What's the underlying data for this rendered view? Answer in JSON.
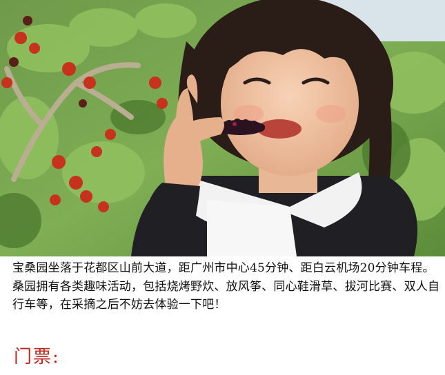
{
  "caption": "宝桑园坐落于花都区山前大道，距广州市中心45分钟、距白云机场20分钟车程。桑园拥有各类趣味活动，包括烧烤野炊、放风筝、同心鞋滑草、拔河比赛、双人自行车等，在采摘之后不妨去体验一下吧！",
  "ticket_heading": "门票:",
  "colors": {
    "heading": "#c0281c",
    "text": "#111111"
  }
}
